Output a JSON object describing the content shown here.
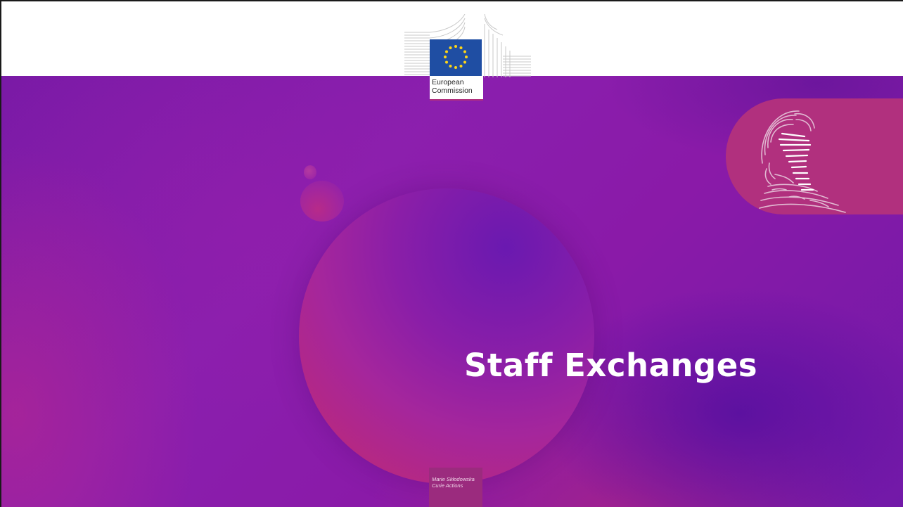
{
  "slide": {
    "title": "Staff Exchanges"
  },
  "logo": {
    "line1": "European",
    "line2": "Commission"
  },
  "programme": {
    "line1": "Marie Skłodowska",
    "line2": "Curie Actions"
  },
  "colors": {
    "purple": "#8a1fae",
    "magenta": "#b1307e",
    "eu_blue": "#1f4ea3",
    "eu_gold": "#ffd617",
    "title_text": "#ffffff"
  },
  "icons": {
    "logo": "european-commission-logo-icon",
    "portrait": "marie-curie-portrait-icon"
  }
}
